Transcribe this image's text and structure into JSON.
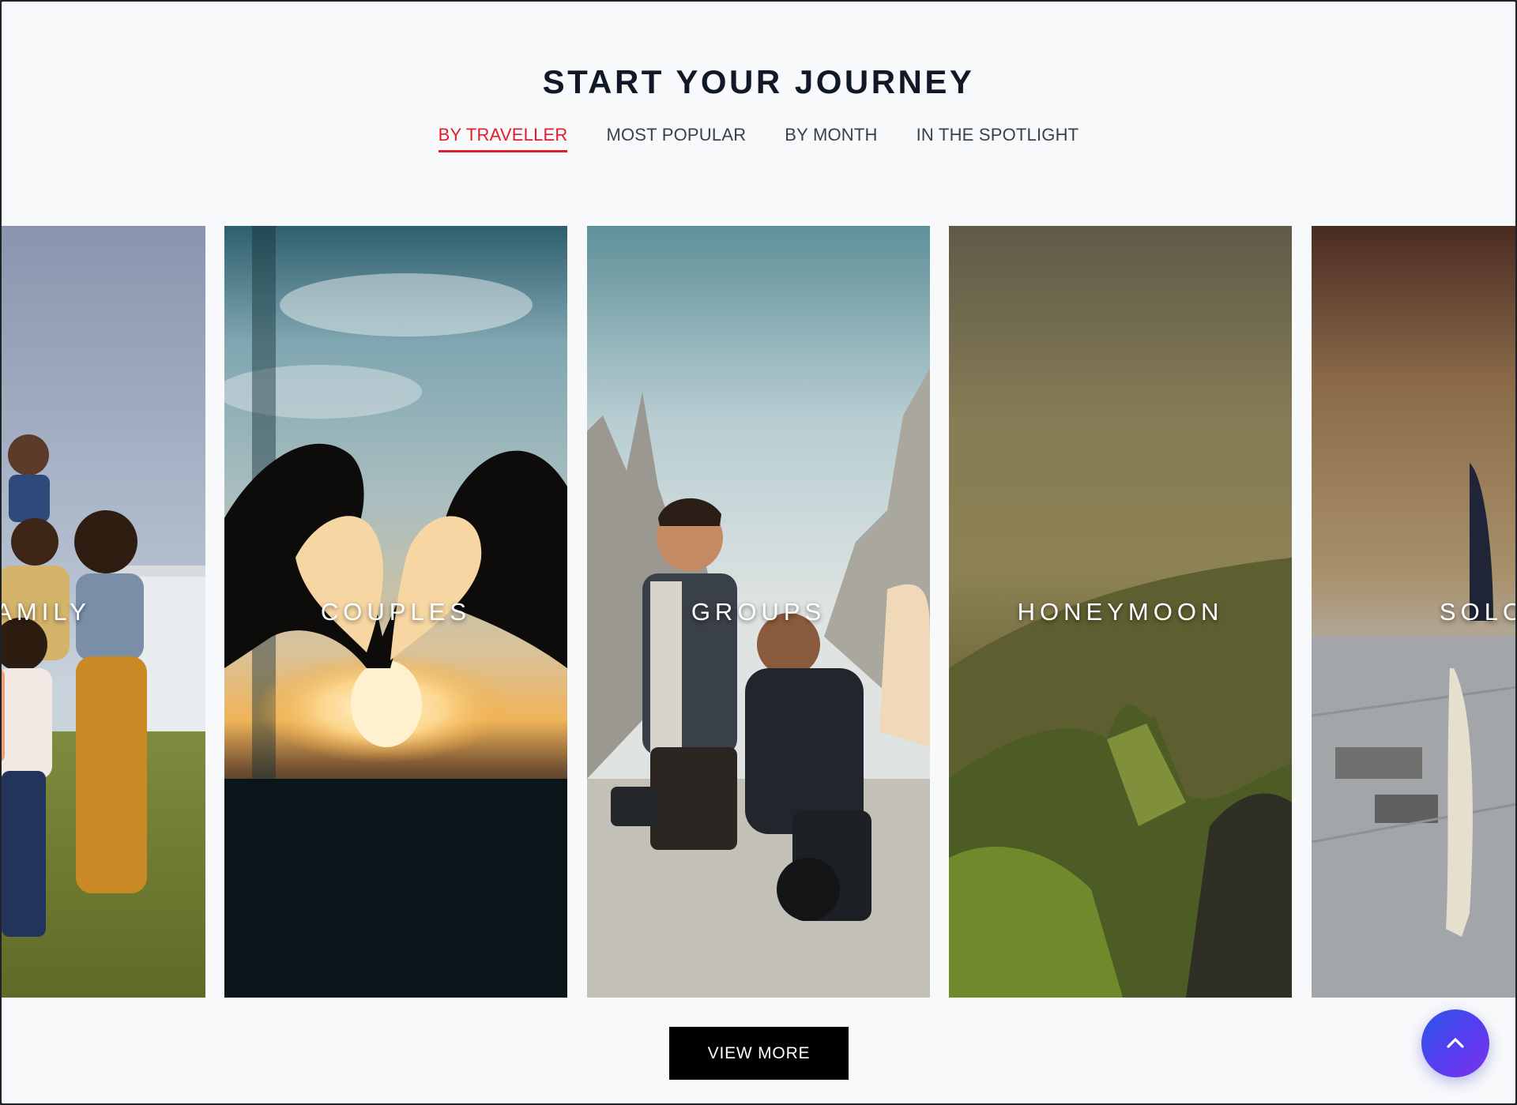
{
  "section": {
    "title": "START YOUR JOURNEY"
  },
  "tabs": [
    {
      "label": "BY TRAVELLER",
      "active": true
    },
    {
      "label": "MOST POPULAR",
      "active": false
    },
    {
      "label": "BY MONTH",
      "active": false
    },
    {
      "label": "IN THE SPOTLIGHT",
      "active": false
    }
  ],
  "cards": [
    {
      "label": "FAMILY"
    },
    {
      "label": "COUPLES"
    },
    {
      "label": "GROUPS"
    },
    {
      "label": "HONEYMOON"
    },
    {
      "label": "SOLO"
    }
  ],
  "actions": {
    "view_more_label": "VIEW MORE",
    "scroll_top_icon": "chevron-up-icon"
  },
  "colors": {
    "accent": "#e11d2a",
    "background": "#f8f9fb",
    "button": "#000000",
    "fab": "#4a47ee"
  }
}
